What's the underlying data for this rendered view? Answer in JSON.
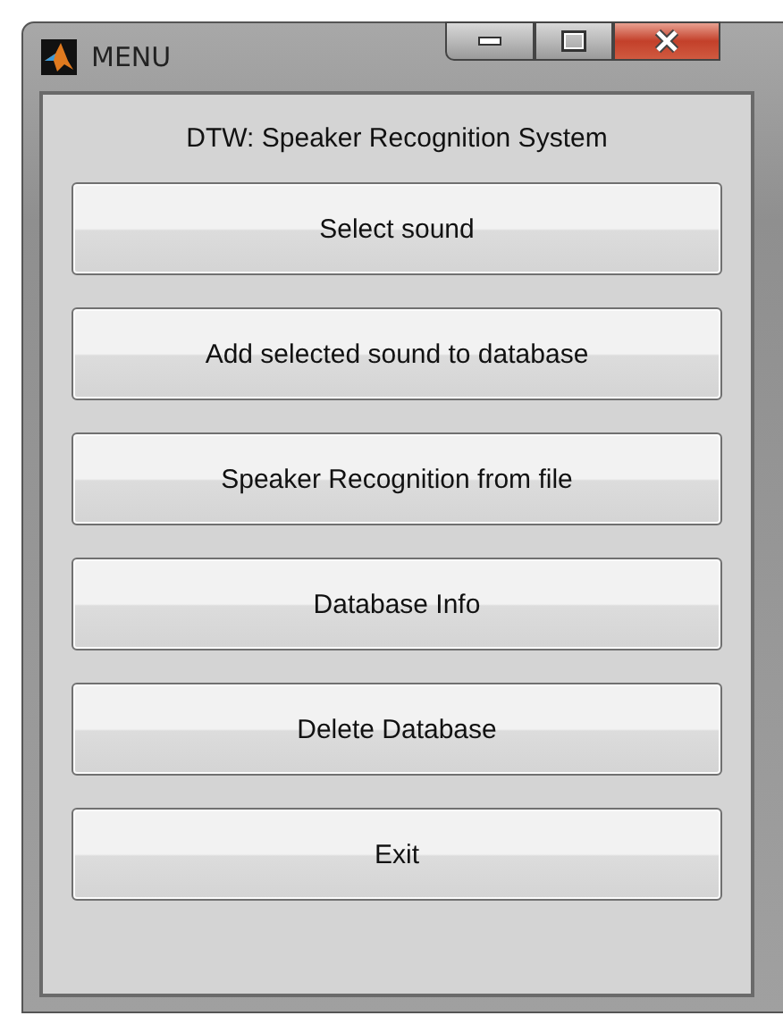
{
  "window": {
    "title": "MENU"
  },
  "heading": "DTW: Speaker Recognition System",
  "buttons": [
    "Select sound",
    "Add selected sound to database",
    "Speaker Recognition from file",
    "Database Info",
    "Delete Database",
    "Exit"
  ]
}
